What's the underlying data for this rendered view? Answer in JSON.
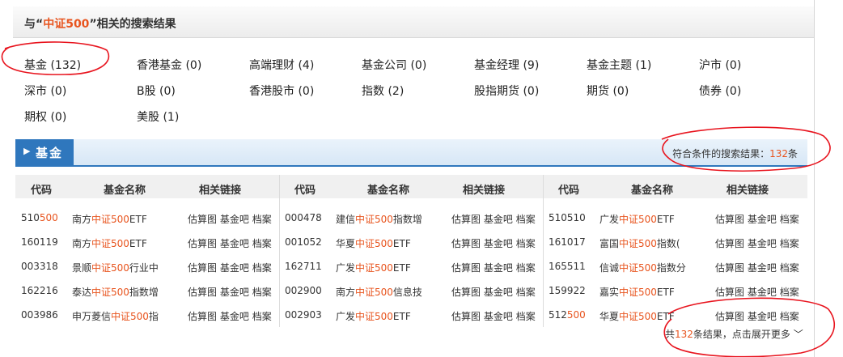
{
  "header": {
    "prefix": "与“",
    "keyword": "中证500",
    "suffix": "”相关的搜索结果"
  },
  "categories": [
    {
      "label": "基金 (132)"
    },
    {
      "label": "香港基金 (0)"
    },
    {
      "label": "高端理财 (4)"
    },
    {
      "label": "基金公司 (0)"
    },
    {
      "label": "基金经理 (9)"
    },
    {
      "label": "基金主题 (1)"
    },
    {
      "label": "沪市 (0)"
    },
    {
      "label": "深市 (0)"
    },
    {
      "label": "B股 (0)"
    },
    {
      "label": "香港股市 (0)"
    },
    {
      "label": "指数 (2)"
    },
    {
      "label": "股指期货 (0)"
    },
    {
      "label": "期货 (0)"
    },
    {
      "label": "债券 (0)"
    },
    {
      "label": "期权 (0)"
    },
    {
      "label": "美股 (1)"
    }
  ],
  "section": {
    "tab_label": "基金",
    "count_prefix": "符合条件的搜索结果：",
    "count": "132",
    "count_suffix": "条"
  },
  "table": {
    "headers": [
      "代码",
      "基金名称",
      "相关链接"
    ],
    "link_labels": [
      "估算图",
      "基金吧",
      "档案"
    ],
    "columns": [
      [
        {
          "code_a": "510",
          "code_b": "500",
          "code_c": "",
          "name_a": "南方",
          "name_hl": "中证500",
          "name_b": "ETF"
        },
        {
          "code_a": "160119",
          "code_b": "",
          "code_c": "",
          "name_a": "南方",
          "name_hl": "中证500",
          "name_b": "ETF"
        },
        {
          "code_a": "003318",
          "code_b": "",
          "code_c": "",
          "name_a": "景顺",
          "name_hl": "中证500",
          "name_b": "行业中"
        },
        {
          "code_a": "162216",
          "code_b": "",
          "code_c": "",
          "name_a": "泰达",
          "name_hl": "中证500",
          "name_b": "指数增"
        },
        {
          "code_a": "003986",
          "code_b": "",
          "code_c": "",
          "name_a": "申万菱信",
          "name_hl": "中证500",
          "name_b": "指"
        }
      ],
      [
        {
          "code_a": "000478",
          "code_b": "",
          "code_c": "",
          "name_a": "建信",
          "name_hl": "中证500",
          "name_b": "指数增"
        },
        {
          "code_a": "001052",
          "code_b": "",
          "code_c": "",
          "name_a": "华夏",
          "name_hl": "中证500",
          "name_b": "ETF"
        },
        {
          "code_a": "162711",
          "code_b": "",
          "code_c": "",
          "name_a": "广发",
          "name_hl": "中证500",
          "name_b": "ETF"
        },
        {
          "code_a": "002900",
          "code_b": "",
          "code_c": "",
          "name_a": "南方",
          "name_hl": "中证500",
          "name_b": "信息技"
        },
        {
          "code_a": "002903",
          "code_b": "",
          "code_c": "",
          "name_a": "广发",
          "name_hl": "中证500",
          "name_b": "ETF"
        }
      ],
      [
        {
          "code_a": "510510",
          "code_b": "",
          "code_c": "",
          "name_a": "广发",
          "name_hl": "中证500",
          "name_b": "ETF"
        },
        {
          "code_a": "161017",
          "code_b": "",
          "code_c": "",
          "name_a": "富国",
          "name_hl": "中证500",
          "name_b": "指数("
        },
        {
          "code_a": "165511",
          "code_b": "",
          "code_c": "",
          "name_a": "信诚",
          "name_hl": "中证500",
          "name_b": "指数分"
        },
        {
          "code_a": "159922",
          "code_b": "",
          "code_c": "",
          "name_a": "嘉实",
          "name_hl": "中证500",
          "name_b": "ETF"
        },
        {
          "code_a": "512",
          "code_b": "500",
          "code_c": "",
          "name_a": "华夏",
          "name_hl": "中证500",
          "name_b": "ETF"
        }
      ]
    ]
  },
  "more": {
    "prefix": "共",
    "count": "132",
    "suffix": "条结果，点击展开更多",
    "icon": "chevron-down-icon"
  },
  "annotation_color": "#e8141e"
}
